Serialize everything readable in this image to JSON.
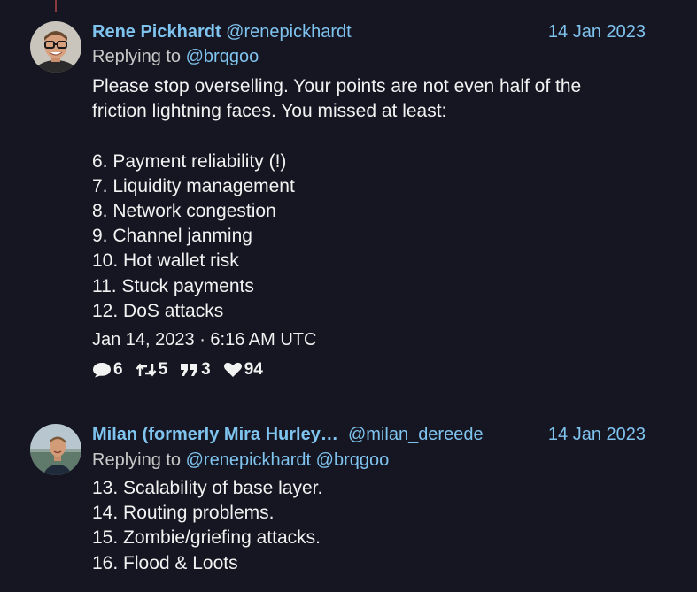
{
  "tweets": [
    {
      "author_name": "Rene Pickhardt",
      "handle": "@renepickhardt",
      "date": "14 Jan 2023",
      "replying_label": "Replying to",
      "replying_to": [
        "@brqgoo"
      ],
      "lines": [
        "Please stop overselling. Your points are not even half of the",
        "friction lightning faces. You missed at least:",
        "",
        "6. Payment reliability (!)",
        "7. Liquidity management",
        "8. Network congestion",
        "9. Channel janming",
        "10. Hot wallet risk",
        "11. Stuck payments",
        "12. DoS attacks"
      ],
      "timestamp": "Jan 14, 2023 · 6:16 AM UTC",
      "stats": {
        "replies": "6",
        "retweets": "5",
        "quotes": "3",
        "likes": "94"
      },
      "icons": {
        "replies": "comment-icon",
        "retweets": "retweet-icon",
        "quotes": "quote-icon",
        "likes": "heart-icon"
      }
    },
    {
      "author_name": "Milan (formerly Mira Hurley…",
      "handle": "@milan_dereede",
      "date": "14 Jan 2023",
      "replying_label": "Replying to",
      "replying_to": [
        "@renepickhardt",
        "@brqgoo"
      ],
      "lines": [
        "13. Scalability of base layer.",
        "14. Routing problems.",
        "15. Zombie/griefing attacks.",
        "16. Flood & Loots"
      ]
    }
  ],
  "colors": {
    "background": "#161622",
    "link": "#7fc3ef",
    "text": "#f2f2f2",
    "muted": "#c8c8c8"
  }
}
